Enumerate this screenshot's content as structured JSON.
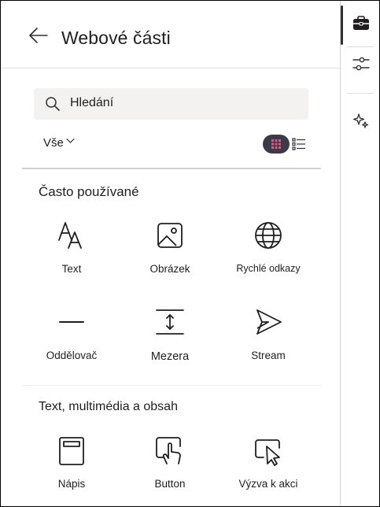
{
  "header": {
    "title": "Webové části"
  },
  "search": {
    "value": "Hledání"
  },
  "filter": {
    "label": "Vše"
  },
  "sections": [
    {
      "title": "Často používané",
      "items": [
        {
          "label": "Text",
          "icon": "text-icon"
        },
        {
          "label": "Obrázek",
          "icon": "image-icon"
        },
        {
          "label": "Rychlé odkazy",
          "icon": "globe-icon"
        },
        {
          "label": "Oddělovač",
          "icon": "divider-icon"
        },
        {
          "label": "Mezera",
          "icon": "spacer-icon"
        },
        {
          "label": "Stream",
          "icon": "stream-icon"
        }
      ]
    },
    {
      "title": "Text, multimédia a obsah",
      "items": [
        {
          "label": "Nápis",
          "icon": "banner-icon"
        },
        {
          "label": "Button",
          "icon": "button-tap-icon"
        },
        {
          "label": "Výzva k akci",
          "icon": "call-to-action-icon"
        }
      ]
    }
  ],
  "rail": {
    "items": [
      "toolbox-icon",
      "settings-sliders-icon",
      "sparkle-icon"
    ]
  },
  "colors": {
    "text": "#201f1e",
    "view_toggle_active": "#3b3a48",
    "search_bg": "#f3f2f1",
    "grid_dots": "#e8557a"
  }
}
